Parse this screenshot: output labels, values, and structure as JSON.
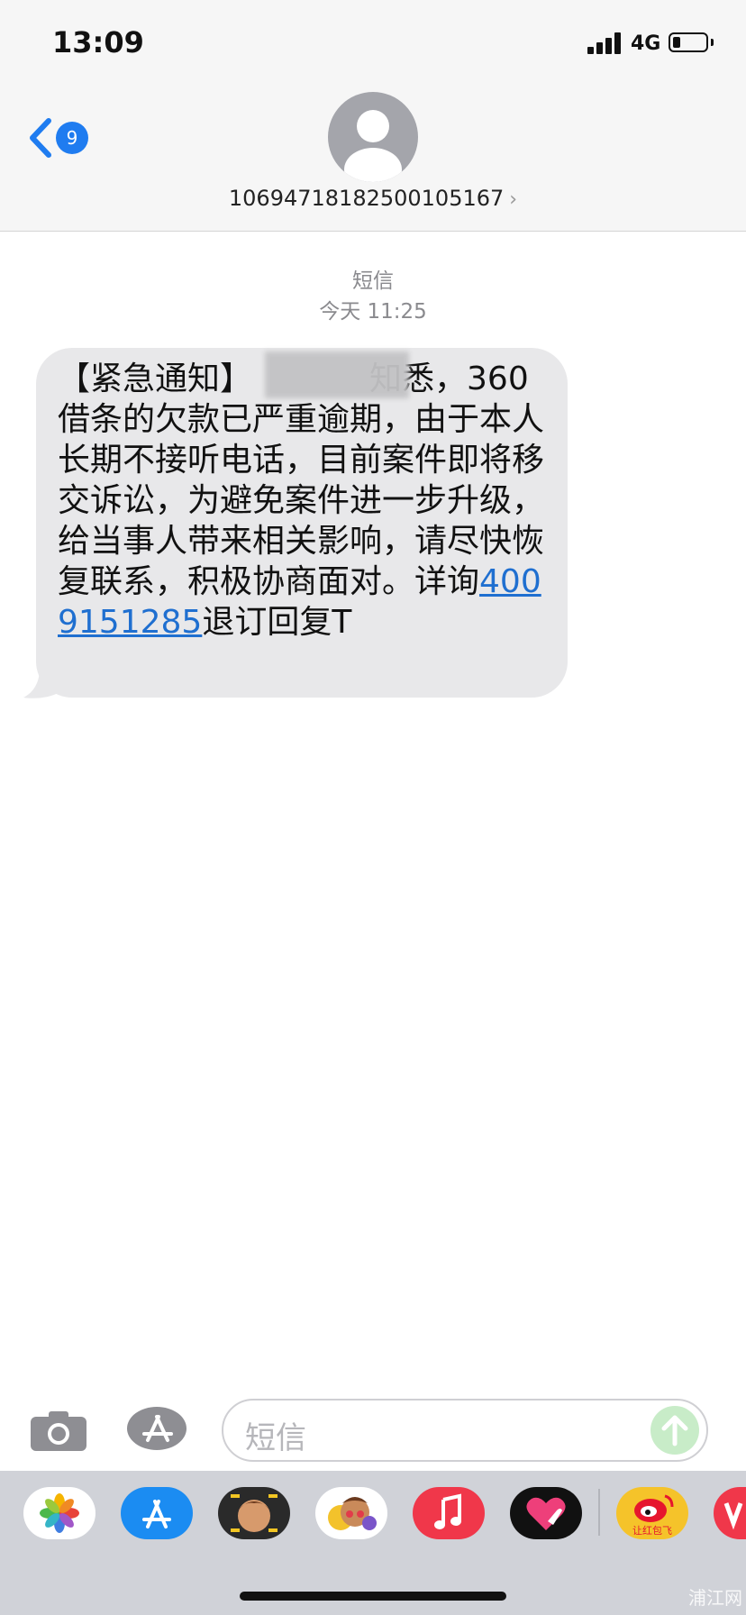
{
  "status_bar": {
    "time": "13:09",
    "network": "4G"
  },
  "header": {
    "back_badge": "9",
    "contact": "10694718182500105167",
    "contact_chevron": "›"
  },
  "thread": {
    "service": "短信",
    "timestamp": "今天 11:25"
  },
  "message": {
    "text_before": "【紧急通知】",
    "text_mid": "知悉，360借条的欠款已严重逾期，由于本人长期不接听电话，目前案件即将移交诉讼，为避免案件进一步升级，给当事人带来相关影响，请尽快恢复联系，积极协商面对。详询",
    "phone": "4009151285",
    "text_after": "退订回复T"
  },
  "composer": {
    "placeholder": "短信"
  },
  "app_tray": {
    "apps": [
      {
        "name": "photos"
      },
      {
        "name": "app-store"
      },
      {
        "name": "memoji"
      },
      {
        "name": "animoji"
      },
      {
        "name": "music"
      },
      {
        "name": "digital-touch"
      },
      {
        "name": "weibo",
        "label": "让红包飞"
      },
      {
        "name": "partial-app"
      }
    ]
  },
  "watermark": "浦江网",
  "colors": {
    "link": "#1f6fd0",
    "bubble": "#e8e8ea",
    "accent": "#1f7cf0"
  }
}
